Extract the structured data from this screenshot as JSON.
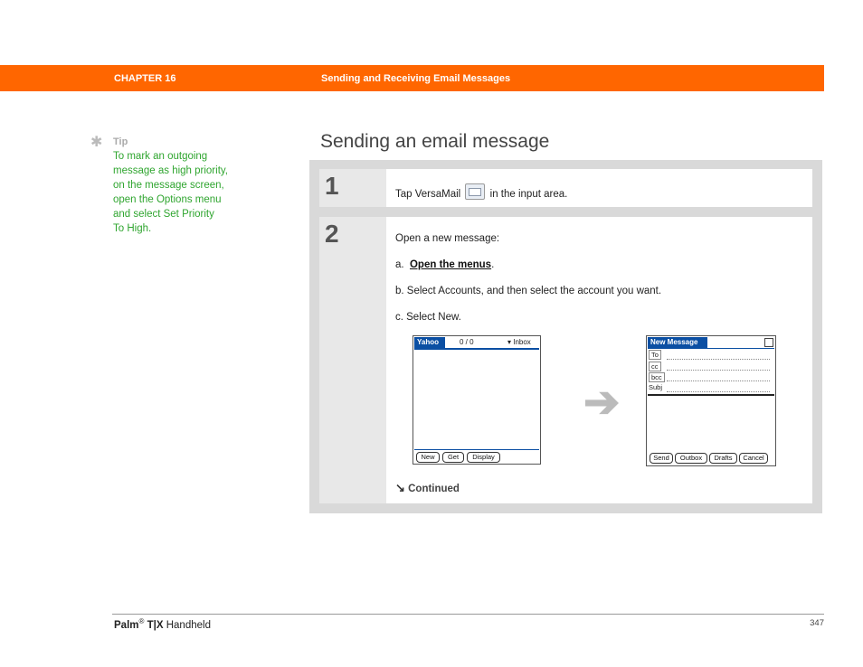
{
  "header": {
    "chapter": "CHAPTER 16",
    "chapter_title": "Sending and Receiving Email Messages"
  },
  "tip": {
    "icon": "asterisk-icon",
    "label": "Tip",
    "lines": [
      "To mark an outgoing",
      "message as high priority,",
      "on the message screen,",
      "open the Options menu",
      "and select Set Priority",
      "To High."
    ]
  },
  "section_title": "Sending an email message",
  "step1": {
    "number": "1",
    "text_before": "Tap VersaMail",
    "text_after": " in the input area."
  },
  "step2": {
    "number": "2",
    "intro": "Open a new message:",
    "a_prefix": "a.",
    "a_link": "Open the menus",
    "a_suffix": ".",
    "b": "b.  Select Accounts, and then select the account you want.",
    "c": "c.  Select New.",
    "continued": "Continued"
  },
  "screen_inbox": {
    "title": "Yahoo",
    "count": "0 / 0",
    "folder": "▾ Inbox",
    "buttons": [
      "New",
      "Get",
      "Display"
    ]
  },
  "screen_new": {
    "title": "New Message",
    "fields": [
      "To",
      "cc",
      "bcc",
      "Subj"
    ],
    "buttons": [
      "Send",
      "Outbox",
      "Drafts",
      "Cancel"
    ]
  },
  "footer": {
    "brand": "Palm",
    "reg": "®",
    "model": "T|X",
    "suffix": "Handheld",
    "page": "347"
  }
}
